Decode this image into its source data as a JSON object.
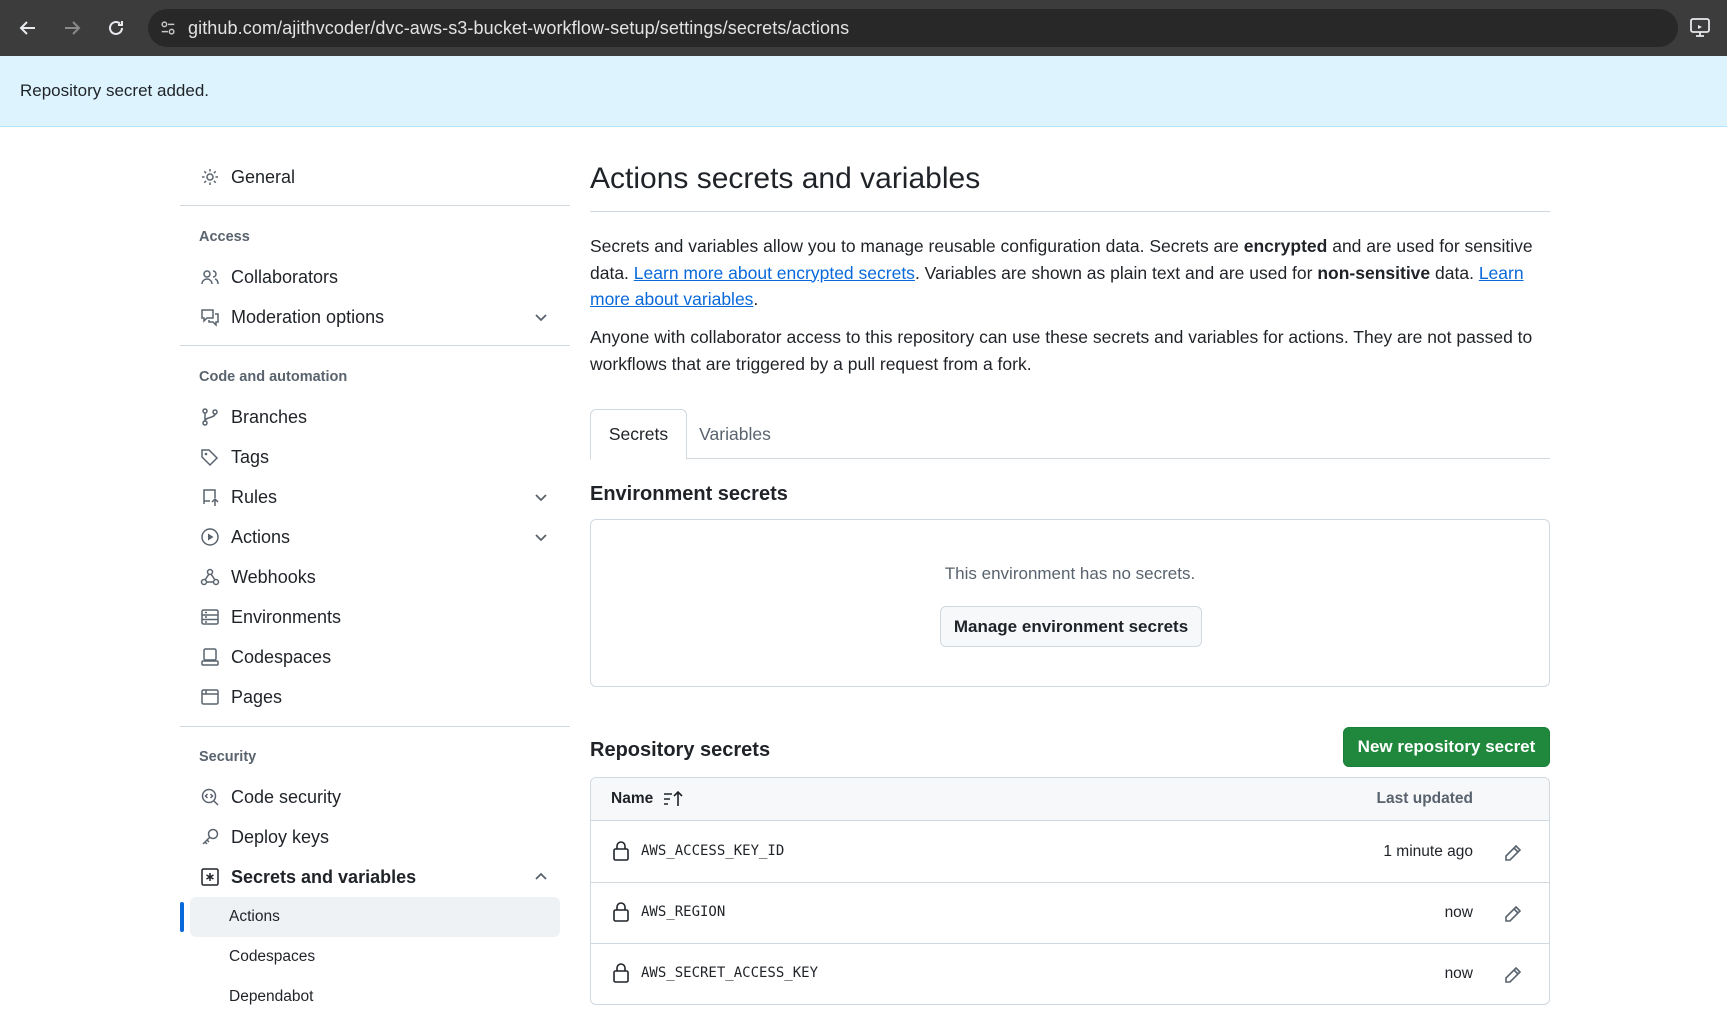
{
  "browser": {
    "url": "github.com/ajithvcoder/dvc-aws-s3-bucket-workflow-setup/settings/secrets/actions"
  },
  "flash": {
    "message": "Repository secret added."
  },
  "sidebar": {
    "general": "General",
    "access_heading": "Access",
    "collaborators": "Collaborators",
    "moderation": "Moderation options",
    "code_heading": "Code and automation",
    "branches": "Branches",
    "tags": "Tags",
    "rules": "Rules",
    "actions": "Actions",
    "webhooks": "Webhooks",
    "environments": "Environments",
    "codespaces": "Codespaces",
    "pages": "Pages",
    "security_heading": "Security",
    "code_security": "Code security",
    "deploy_keys": "Deploy keys",
    "secrets_vars": "Secrets and variables",
    "sub_actions": "Actions",
    "sub_codespaces": "Codespaces",
    "sub_dependabot": "Dependabot"
  },
  "main": {
    "title": "Actions secrets and variables",
    "p1": {
      "t1": "Secrets and variables allow you to manage reusable configuration data. Secrets are ",
      "b1": "encrypted",
      "t2": " and are used for sensitive data. ",
      "link1": "Learn more about encrypted secrets",
      "t3": ". Variables are shown as plain text and are used for ",
      "b2": "non-sensitive",
      "t4": " data. ",
      "link2": "Learn more about variables",
      "t5": "."
    },
    "p2": "Anyone with collaborator access to this repository can use these secrets and variables for actions. They are not passed to workflows that are triggered by a pull request from a fork.",
    "tabs": [
      {
        "label": "Secrets"
      },
      {
        "label": "Variables"
      }
    ],
    "env_heading": "Environment secrets",
    "env_empty": "This environment has no secrets.",
    "manage_env_button": "Manage environment secrets",
    "repo_heading": "Repository secrets",
    "new_secret_button": "New repository secret",
    "table": {
      "col_name": "Name",
      "col_updated": "Last updated",
      "rows": [
        {
          "name": "AWS_ACCESS_KEY_ID",
          "updated": "1 minute ago"
        },
        {
          "name": "AWS_REGION",
          "updated": "now"
        },
        {
          "name": "AWS_SECRET_ACCESS_KEY",
          "updated": "now"
        }
      ]
    }
  }
}
